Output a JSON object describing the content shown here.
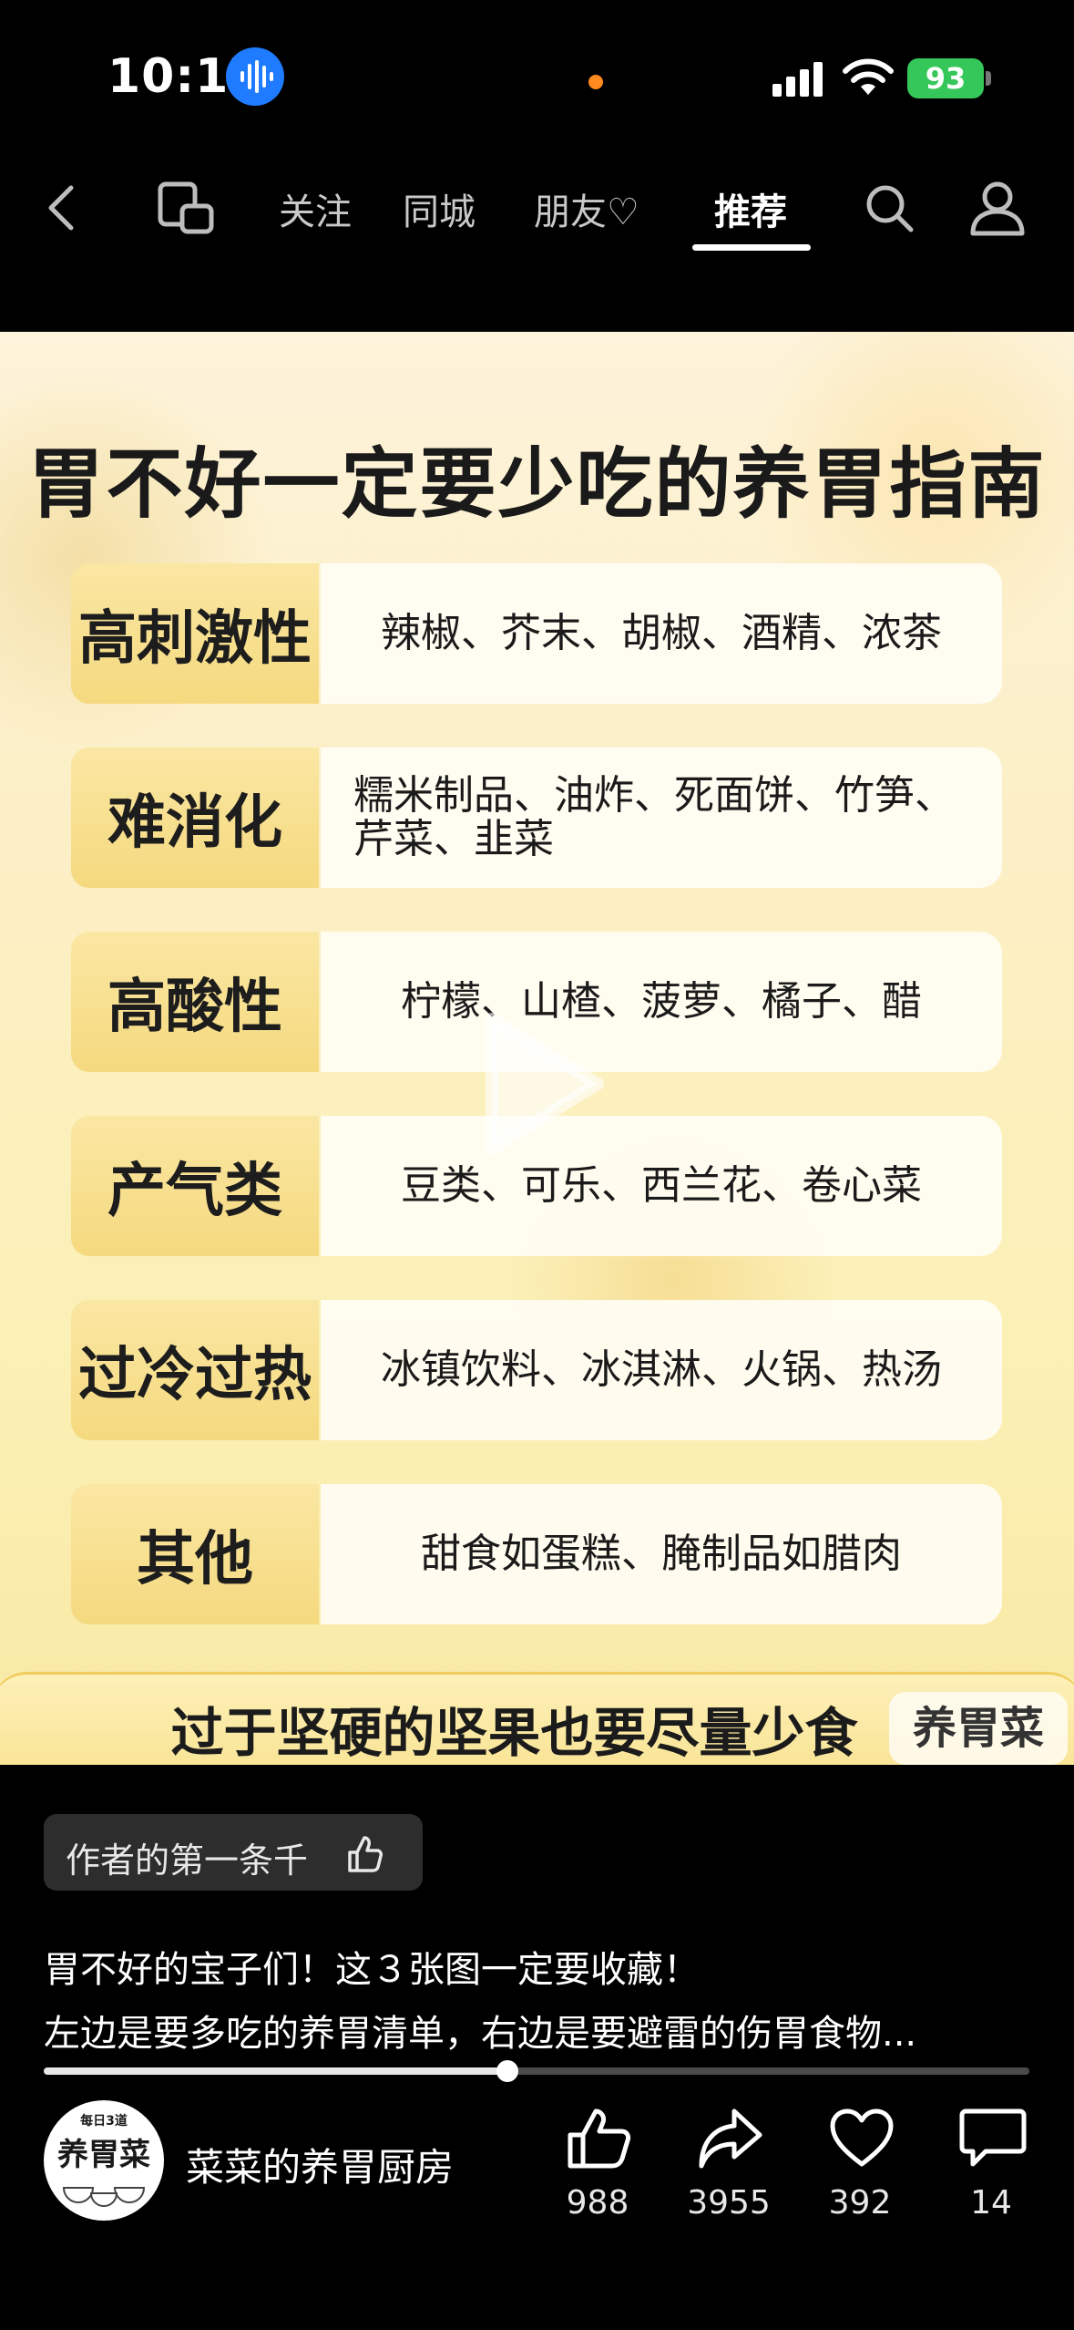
{
  "status_bar": {
    "time": "10:17",
    "battery": "93",
    "colors": {
      "mic_badge": "#1f7bff",
      "battery": "#35c759",
      "dot": "#ff8a1f"
    }
  },
  "nav": {
    "tabs": [
      {
        "label": "关注",
        "active": false
      },
      {
        "label": "同城",
        "active": false
      },
      {
        "label": "朋友♡",
        "active": false
      },
      {
        "label": "推荐",
        "active": true
      }
    ],
    "icons": [
      "back-icon",
      "mirror-screen-icon",
      "search-icon",
      "profile-icon"
    ]
  },
  "poster": {
    "title": "胃不好一定要少吃的养胃指南",
    "rows": [
      {
        "category": "高刺激性",
        "items": "辣椒、芥末、胡椒、酒精、浓茶"
      },
      {
        "category": "难消化",
        "items": "糯米制品、油炸、死面饼、竹笋、芹菜、韭菜"
      },
      {
        "category": "高酸性",
        "items": "柠檬、山楂、菠萝、橘子、醋"
      },
      {
        "category": "产气类",
        "items": "豆类、可乐、西兰花、卷心菜"
      },
      {
        "category": "过冷过热",
        "items": "冰镇饮料、冰淇淋、火锅、热汤"
      },
      {
        "category": "其他",
        "items": "甜食如蛋糕、腌制品如腊肉"
      }
    ],
    "banner": "过于坚硬的坚果也要尽量少食",
    "watermark": "养胃菜"
  },
  "post": {
    "tag": "作者的第一条千",
    "description_line1": "胃不好的宝子们！这３张图一定要收藏！",
    "description_line2": "左边是要多吃的养胃清单，右边是要避雷的伤胃食物...",
    "progress": 0.47
  },
  "author": {
    "avatar_top": "每日3道",
    "avatar_main": "养胃菜",
    "name": "菜菜的养胃厨房"
  },
  "actions": [
    {
      "icon": "like-icon",
      "count": "988"
    },
    {
      "icon": "share-icon",
      "count": "3955"
    },
    {
      "icon": "favorite-icon",
      "count": "392"
    },
    {
      "icon": "comment-icon",
      "count": "14"
    }
  ]
}
